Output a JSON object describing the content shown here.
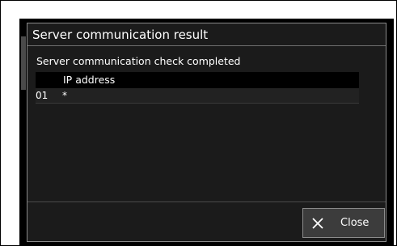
{
  "dialog": {
    "title": "Server communication result",
    "status": "Server communication check completed"
  },
  "table": {
    "header": "IP address",
    "rows": [
      {
        "num": "01",
        "value": "*"
      }
    ]
  },
  "close_button": {
    "label": "Close",
    "icon": "close-icon"
  },
  "colors": {
    "screen_background": "#000000",
    "dialog_background": "#1b1b1b",
    "row_background": "#222222",
    "button_background": "#3c3c3c",
    "text": "#ffffff"
  }
}
